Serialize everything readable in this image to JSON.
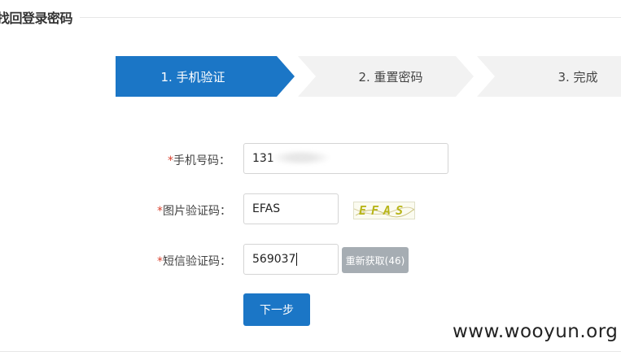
{
  "page": {
    "title": "找回登录密码"
  },
  "steps": [
    {
      "label": "1. 手机验证"
    },
    {
      "label": "2. 重置密码"
    },
    {
      "label": "3. 完成"
    }
  ],
  "form": {
    "required_mark": "*",
    "phone": {
      "label": "手机号码：",
      "value": "131"
    },
    "captcha": {
      "label": "图片验证码：",
      "value": "EFAS",
      "image_text": "EFAS"
    },
    "sms": {
      "label": "短信验证码：",
      "value": "569037",
      "resend_label": "重新获取(46)"
    },
    "next_label": "下一步"
  },
  "watermark": "www.wooyun.org",
  "colors": {
    "accent": "#1b76c6",
    "step_inactive": "#f2f2f2",
    "required": "#d9412e",
    "disabled_button": "#a6adb3"
  }
}
